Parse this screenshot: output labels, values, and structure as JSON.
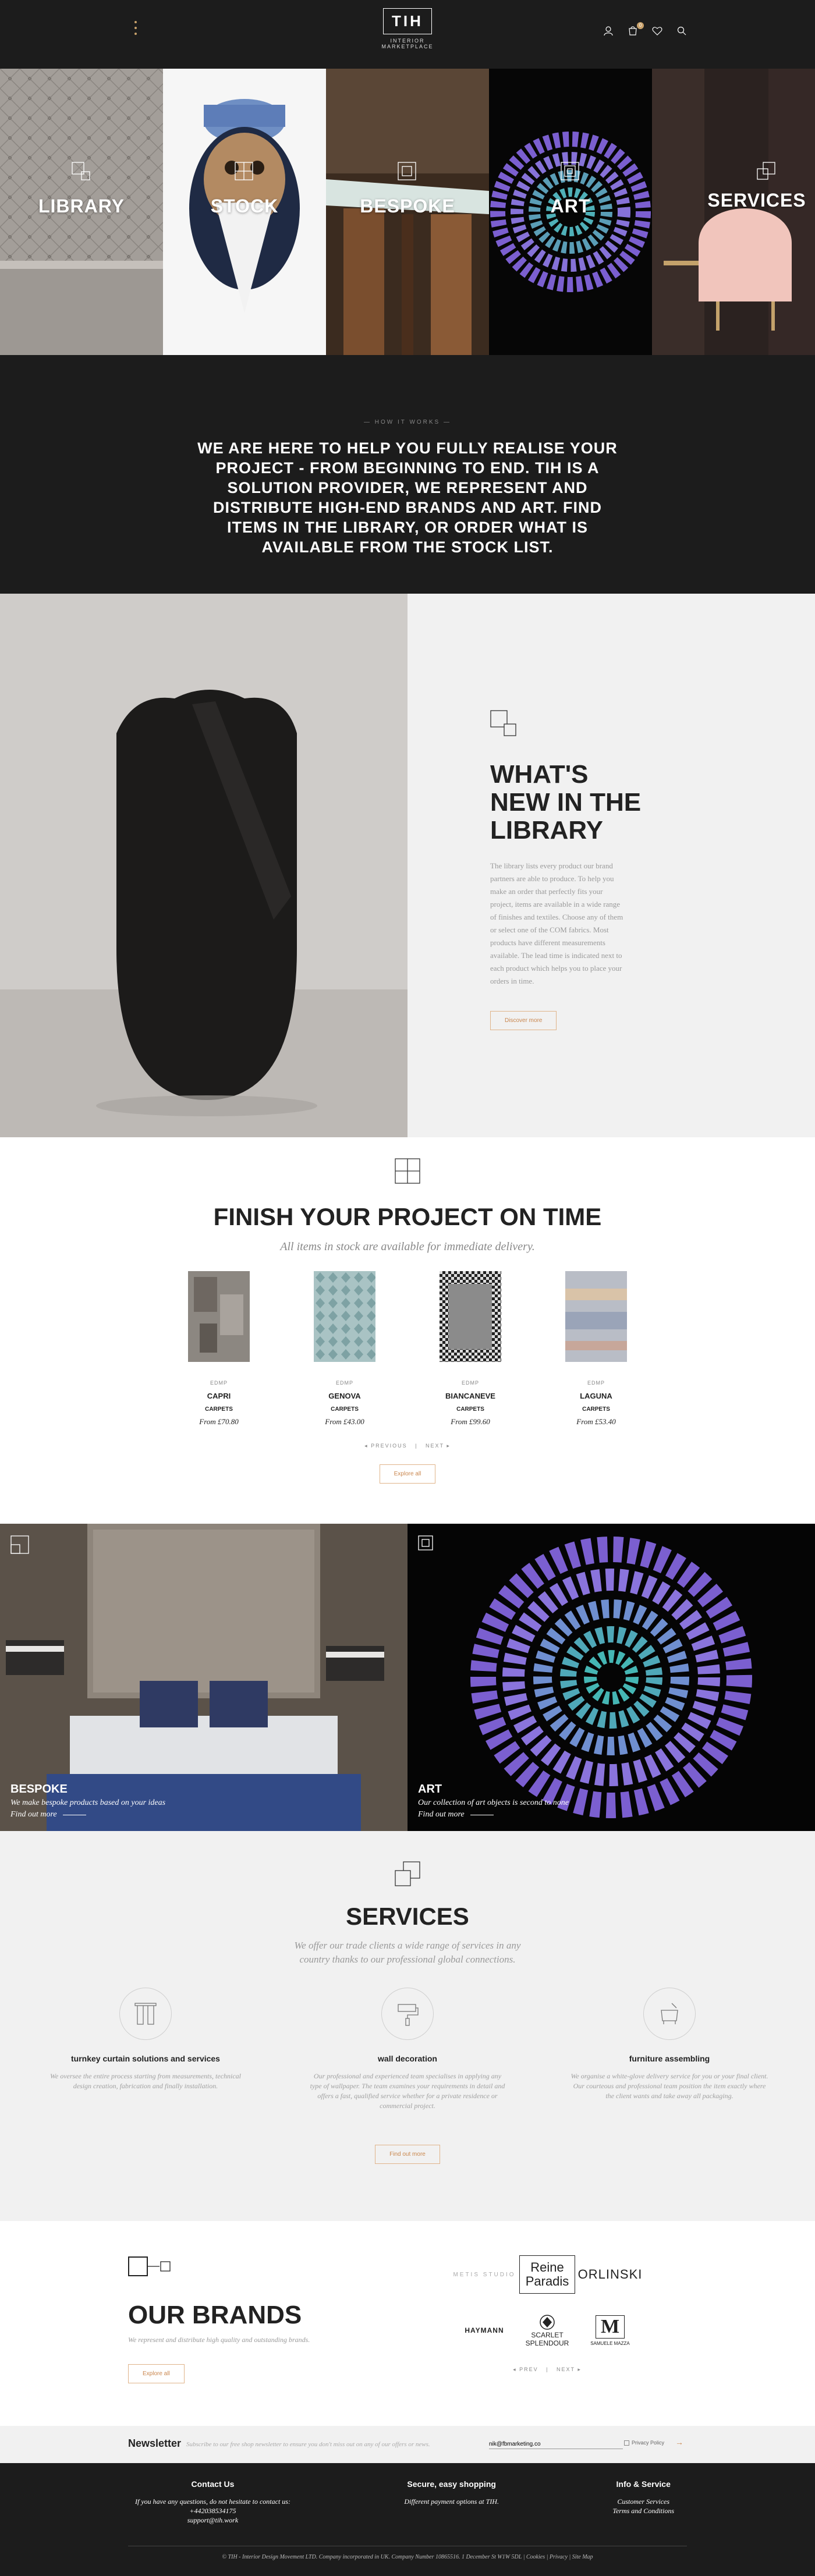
{
  "header": {
    "logo_text": "TIH",
    "logo_sub": "INTERIOR MARKETPLACE",
    "cart_count": "0",
    "accent": "#c9a26b"
  },
  "categories": [
    {
      "label": "LIBRARY"
    },
    {
      "label": "STOCK"
    },
    {
      "label": "BESPOKE"
    },
    {
      "label": "ART"
    },
    {
      "label": "SERVICES"
    }
  ],
  "how": {
    "kicker": "— HOW IT WORKS —",
    "text": "WE ARE HERE TO HELP YOU FULLY REALISE YOUR PROJECT - FROM BEGINNING TO END. TIH IS A SOLUTION PROVIDER, WE REPRESENT AND DISTRIBUTE HIGH-END BRANDS AND ART. FIND ITEMS IN THE LIBRARY, OR ORDER WHAT IS AVAILABLE FROM THE STOCK LIST."
  },
  "whatsnew": {
    "title": "WHAT'S NEW IN THE LIBRARY",
    "body": "The library lists every product our brand partners are able to produce. To help you make an order that perfectly fits your project, items are available in a wide range of finishes and textiles. Choose any of them or select one of the COM fabrics. Most products have different measurements available. The lead time is indicated next to each product which helps you to place your orders in time.",
    "button": "Discover more"
  },
  "finish": {
    "title": "FINISH YOUR PROJECT ON TIME",
    "subtitle": "All items in stock are available for immediate delivery.",
    "products": [
      {
        "brand": "EDMP",
        "name": "CAPRI",
        "category": "CARPETS",
        "price": "From £70.80"
      },
      {
        "brand": "EDMP",
        "name": "GENOVA",
        "category": "CARPETS",
        "price": "From £43.00"
      },
      {
        "brand": "EDMP",
        "name": "BIANCANEVE",
        "category": "CARPETS",
        "price": "From £99.60"
      },
      {
        "brand": "EDMP",
        "name": "LAGUNA",
        "category": "CARPETS",
        "price": "From £53.40"
      }
    ],
    "prev": "◂ PREVIOUS",
    "next": "NEXT ▸",
    "button": "Explore all"
  },
  "duo": {
    "bespoke": {
      "title": "BESPOKE",
      "desc": "We make bespoke products based on your ideas",
      "link": "Find out more"
    },
    "art": {
      "title": "ART",
      "desc": "Our collection of art objects is second to none",
      "link": "Find out more"
    }
  },
  "services": {
    "title": "SERVICES",
    "subtitle": "We offer our trade clients a wide range of services in any country thanks to our professional global connections.",
    "items": [
      {
        "name": "turnkey curtain solutions and services",
        "desc": "We oversee the entire process starting from measurements, technical design creation, fabrication and finally installation.",
        "icon": "curtain-icon"
      },
      {
        "name": "wall decoration",
        "desc": "Our professional and experienced team specialises in applying any type of wallpaper. The team examines your requirements in detail and offers a fast, qualified service whether for a private residence or commercial project.",
        "icon": "paint-roller-icon"
      },
      {
        "name": "furniture assembling",
        "desc": "We organise a white-glove delivery service for you or your final client. Our courteous and professional team position the item exactly where the client wants and take away all packaging.",
        "icon": "furniture-icon"
      }
    ],
    "button": "Find out more"
  },
  "brands": {
    "title": "OUR BRANDS",
    "subtitle": "We represent and distribute high quality and outstanding brands.",
    "button": "Explore all",
    "logos": [
      {
        "name": "METIS STUDIO",
        "top": "METIS STUDIO"
      },
      {
        "name": "Reine Paradis",
        "top": "Reine",
        "bottom": "Paradis"
      },
      {
        "name": "ORLINSKI",
        "top": "ORLINSKI"
      },
      {
        "name": "HAYMANN",
        "top": "HAYMANN"
      },
      {
        "name": "SCARLET SPLENDOUR",
        "top": "SCARLET",
        "bottom": "SPLENDOUR"
      },
      {
        "name": "SAMUELE MAZZA",
        "top": "M",
        "bottom": "SAMUELE MAZZA"
      }
    ],
    "prev": "◂ PREV",
    "next": "NEXT ▸"
  },
  "newsletter": {
    "title": "Newsletter",
    "desc": "Subscribe to our free shop newsletter to ensure you don't miss out on any of our offers or news.",
    "email_value": "nik@fbmarketing.co",
    "privacy": "Privacy Policy"
  },
  "footer": {
    "cols": [
      {
        "title": "Contact Us",
        "lines": [
          "If you have any questions, do not hesitate to contact us:",
          "+442038534175",
          "support@tih.work"
        ]
      },
      {
        "title": "Secure, easy shopping",
        "lines": [
          "Different payment options at TIH."
        ]
      },
      {
        "title": "Info & Service",
        "lines": [
          "Customer Services",
          "Terms and Conditions"
        ]
      }
    ],
    "copyright": "© TIH - Interior Design Movement LTD. Company incorporated in UK. Company Number 10865516. 1 December St W1W 5DL | Cookies | Privacy | Site Map"
  }
}
